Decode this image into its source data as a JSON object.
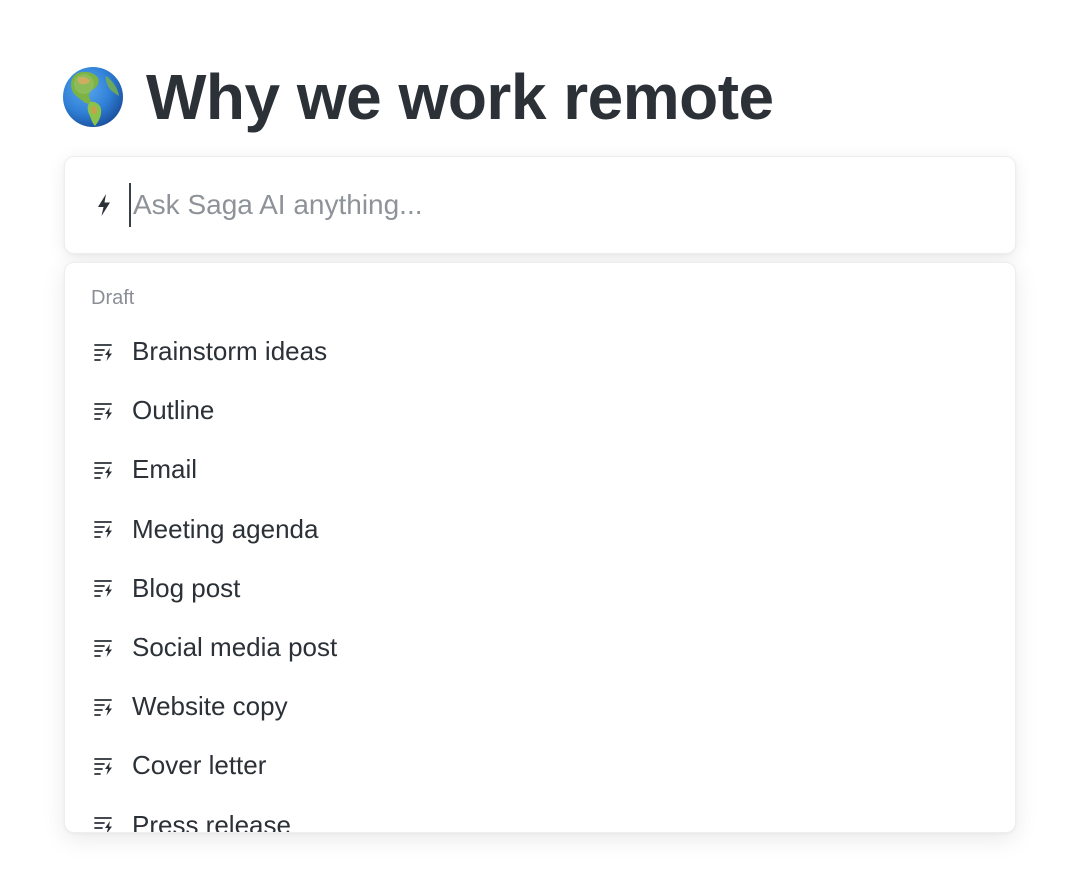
{
  "page": {
    "title": "Why we work remote",
    "icon": "globe-americas-icon"
  },
  "ai_prompt": {
    "icon": "lightning-bolt-icon",
    "placeholder": "Ask Saga AI anything...",
    "value": ""
  },
  "menu": {
    "section_label": "Draft",
    "item_icon": "draft-lines-bolt-icon",
    "items": [
      {
        "label": "Brainstorm ideas"
      },
      {
        "label": "Outline"
      },
      {
        "label": "Email"
      },
      {
        "label": "Meeting agenda"
      },
      {
        "label": "Blog post"
      },
      {
        "label": "Social media post"
      },
      {
        "label": "Website copy"
      },
      {
        "label": "Cover letter"
      },
      {
        "label": "Press release"
      }
    ]
  },
  "colors": {
    "text": "#2b3137",
    "muted": "#8a8f95",
    "placeholder": "#8e9399"
  }
}
